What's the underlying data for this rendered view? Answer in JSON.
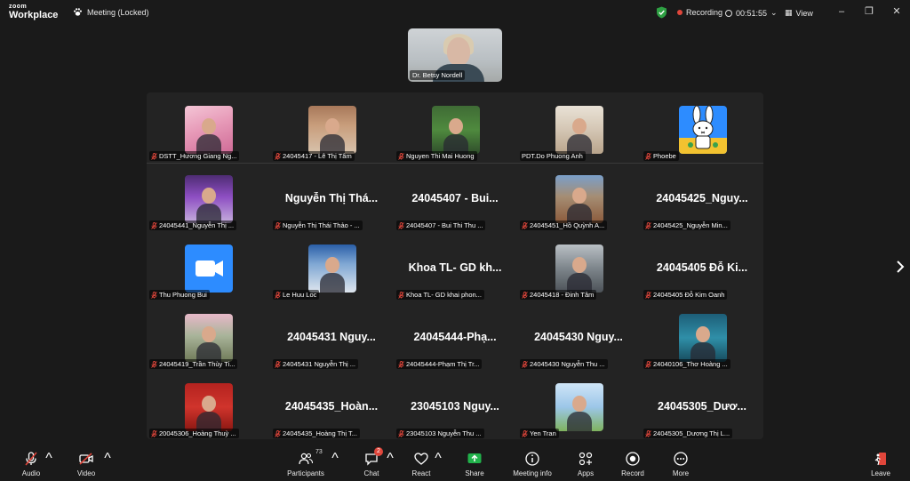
{
  "app": {
    "logo_line1": "zoom",
    "logo_line2": "Workplace",
    "meeting_title": "Meeting (Locked)"
  },
  "status": {
    "recording_label": "Recording",
    "timer": "00:51:55",
    "view_label": "View"
  },
  "speaker": {
    "name": "Dr. Betsy Nordell"
  },
  "colors": {
    "background": "#1a1a1a",
    "gallery_bg": "#232323",
    "muted_red": "#e0463b",
    "secure_green": "#2ea043",
    "share_green": "#21b24b",
    "zoom_blue": "#2d8cff"
  },
  "tiles": [
    {
      "label": "DSTT_Hương Giang Ng...",
      "display": "",
      "muted": true
    },
    {
      "label": "24045417 - Lê Thị Tâm",
      "display": "",
      "muted": true
    },
    {
      "label": "Nguyen Thi Mai Huong",
      "display": "",
      "muted": true
    },
    {
      "label": "PDT.Do Phuong Anh",
      "display": "",
      "muted": false
    },
    {
      "label": "Phoebe",
      "display": "",
      "muted": true
    },
    {
      "label": "24045441_Nguyễn Thị ...",
      "display": "",
      "muted": true
    },
    {
      "label": "Nguyễn Thị Thái Thảo - ...",
      "display": "Nguyễn Thị Thá...",
      "muted": true
    },
    {
      "label": "24045407 - Bui Thi Thu ...",
      "display": "24045407 - Bui...",
      "muted": true
    },
    {
      "label": "24045451_Hồ Quỳnh A...",
      "display": "",
      "muted": true
    },
    {
      "label": "24045425_Nguyễn Min...",
      "display": "24045425_Nguy...",
      "muted": true
    },
    {
      "label": "Thu Phuong Bui",
      "display": "",
      "muted": true
    },
    {
      "label": "Le Huu Loc",
      "display": "",
      "muted": true
    },
    {
      "label": "Khoa TL- GD khai phon...",
      "display": "Khoa TL- GD kh...",
      "muted": true
    },
    {
      "label": "24045418 - Đinh Tâm",
      "display": "",
      "muted": true
    },
    {
      "label": "24045405 Đỗ Kim Oanh",
      "display": "24045405 Đỗ Ki...",
      "muted": true
    },
    {
      "label": "24045419_Trần Thùy Ti...",
      "display": "",
      "muted": true
    },
    {
      "label": "24045431 Nguyễn Thị ...",
      "display": "24045431 Nguy...",
      "muted": true
    },
    {
      "label": "24045444-Phạm Thị Tr...",
      "display": "24045444-Phạ...",
      "muted": true
    },
    {
      "label": "24045430 Nguyễn Thu ...",
      "display": "24045430 Nguy...",
      "muted": true
    },
    {
      "label": "24040106_Thơ Hoàng ...",
      "display": "",
      "muted": true
    },
    {
      "label": "20045306_Hoàng Thuỳ ...",
      "display": "",
      "muted": true
    },
    {
      "label": "24045435_Hoàng Thị T...",
      "display": "24045435_Hoàn...",
      "muted": true
    },
    {
      "label": "23045103 Nguyễn Thu ...",
      "display": "23045103 Nguy...",
      "muted": true
    },
    {
      "label": "Yen Tran",
      "display": "",
      "muted": true
    },
    {
      "label": "24045305_Dương Thị L...",
      "display": "24045305_Dươ...",
      "muted": true
    }
  ],
  "toolbar": {
    "audio": "Audio",
    "video": "Video",
    "participants": "Participants",
    "participants_count": "73",
    "chat": "Chat",
    "chat_badge": "2",
    "react": "React",
    "share": "Share",
    "meeting_info": "Meeting info",
    "apps": "Apps",
    "record": "Record",
    "more": "More",
    "leave": "Leave"
  }
}
